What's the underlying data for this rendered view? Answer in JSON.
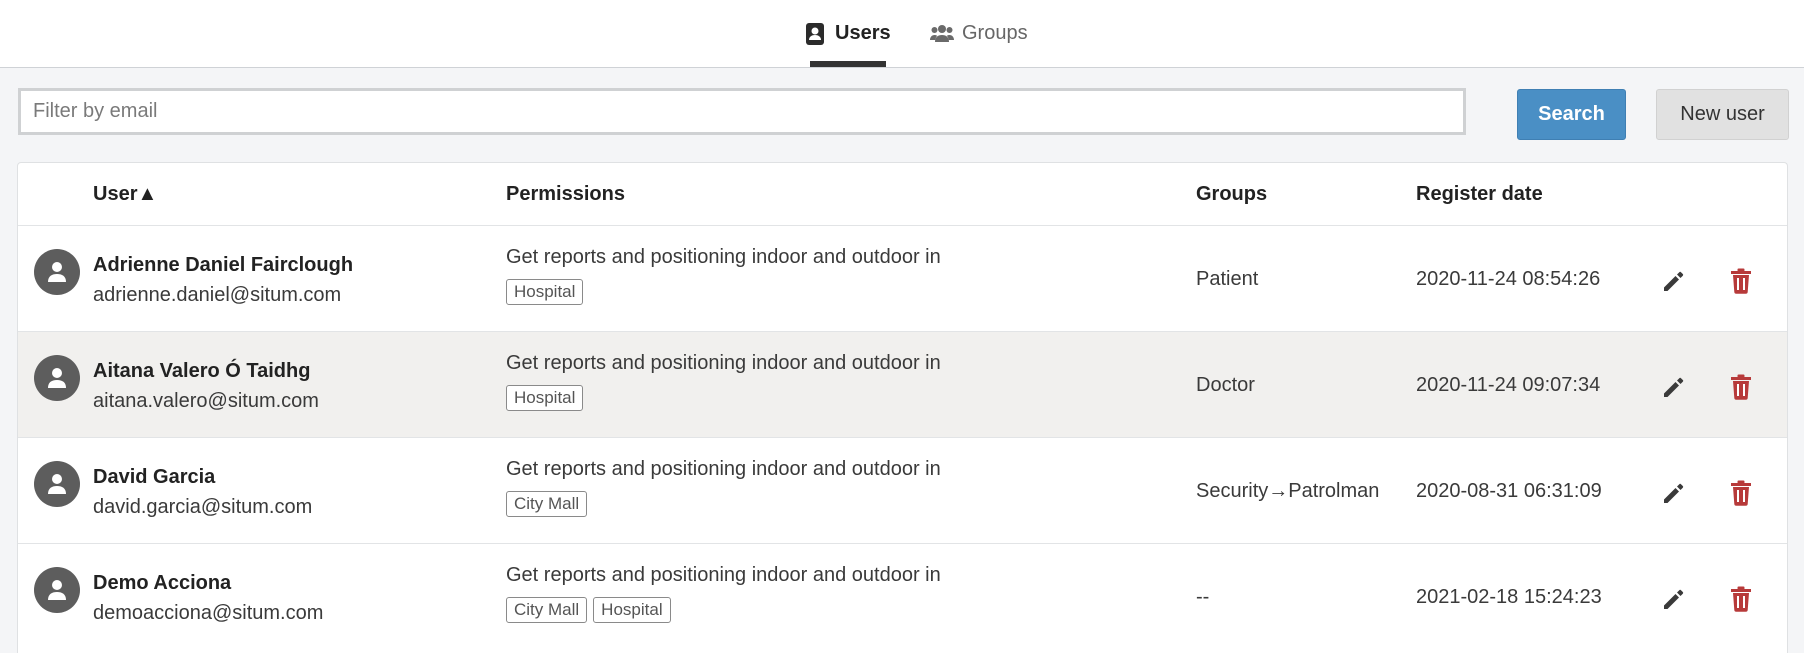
{
  "tabs": {
    "users_label": "Users",
    "groups_label": "Groups",
    "active": "users"
  },
  "toolbar": {
    "filter_placeholder": "Filter by email",
    "filter_value": "",
    "search_label": "Search",
    "new_user_label": "New user"
  },
  "table": {
    "columns": {
      "user": "User▲",
      "permissions": "Permissions",
      "groups": "Groups",
      "register_date": "Register date"
    },
    "rows": [
      {
        "name": "Adrienne Daniel Fairclough",
        "email": "adrienne.daniel@situm.com",
        "permission": "Get reports and positioning indoor and outdoor in",
        "tags": [
          "Hospital"
        ],
        "group": "Patient",
        "date": "2020-11-24 08:54:26"
      },
      {
        "name": "Aitana Valero Ó Taidhg",
        "email": "aitana.valero@situm.com",
        "permission": "Get reports and positioning indoor and outdoor in",
        "tags": [
          "Hospital"
        ],
        "group": "Doctor",
        "date": "2020-11-24 09:07:34"
      },
      {
        "name": "David Garcia",
        "email": "david.garcia@situm.com",
        "permission": "Get reports and positioning indoor and outdoor in",
        "tags": [
          "City Mall"
        ],
        "group": "Security→Patrolman",
        "date": "2020-08-31 06:31:09"
      },
      {
        "name": "Demo Acciona",
        "email": "demoacciona@situm.com",
        "permission": "Get reports and positioning indoor and outdoor in",
        "tags": [
          "City Mall",
          "Hospital"
        ],
        "group": "--",
        "date": "2021-02-18 15:24:23"
      }
    ]
  },
  "colors": {
    "search_button": "#4a8fc5",
    "delete_icon": "#b73a3a",
    "edit_icon": "#3a3a3a",
    "avatar": "#5d5d5d"
  },
  "icons": {
    "users_tab": "contact-card-icon",
    "groups_tab": "users-icon",
    "avatar": "user-icon",
    "edit": "pencil-icon",
    "delete": "trash-icon"
  }
}
